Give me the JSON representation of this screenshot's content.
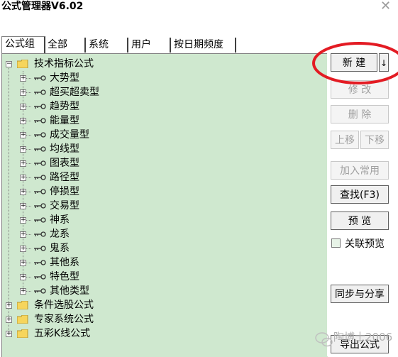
{
  "window": {
    "title": "公式管理器V6.02"
  },
  "tabs": [
    "公式组",
    "全部",
    "系统",
    "用户",
    "按日期频度"
  ],
  "tree": {
    "root": {
      "label": "技术指标公式",
      "expander": "−"
    },
    "children": [
      "大势型",
      "超买超卖型",
      "趋势型",
      "能量型",
      "成交量型",
      "均线型",
      "图表型",
      "路径型",
      "停损型",
      "交易型",
      "神系",
      "龙系",
      "鬼系",
      "其他系",
      "特色型",
      "其他类型"
    ],
    "others": [
      "条件选股公式",
      "专家系统公式",
      "五彩K线公式"
    ],
    "child_expander": "+"
  },
  "buttons": {
    "new": "新  建",
    "new_arrow": "↓",
    "edit": "修  改",
    "delete": "删  除",
    "move_up": "上移",
    "move_down": "下移",
    "add_common": "加入常用",
    "find": "查找(F3)",
    "preview": "预  览",
    "sync_share": "同步与分享",
    "export": "导出公式"
  },
  "link_preview": {
    "label": "关联预览",
    "checked": false
  },
  "watermark": "陶博士2006",
  "colors": {
    "tree_bg": "#cfe8cf",
    "highlight": "#e31b23"
  },
  "icons": [
    "close-icon",
    "folder-icon",
    "key-icon",
    "chevron-down-icon",
    "wechat-icon"
  ]
}
